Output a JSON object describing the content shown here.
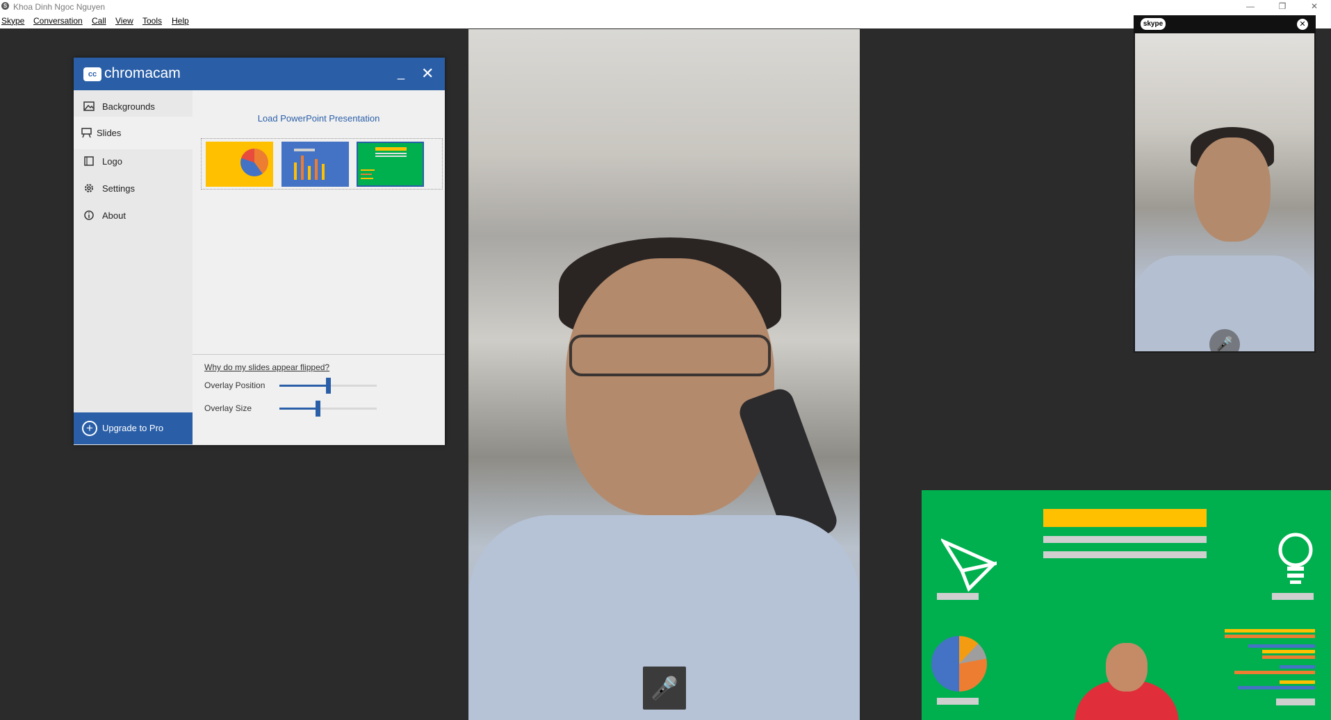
{
  "window": {
    "title": "Khoa Dinh Ngoc Nguyen",
    "app_icon": "S",
    "minimize": "—",
    "maximize": "❐",
    "close": "✕"
  },
  "menu": [
    "Skype",
    "Conversation",
    "Call",
    "View",
    "Tools",
    "Help"
  ],
  "self_view": {
    "logo": "skype",
    "close_icon": "✕",
    "mute_icon": "🎤"
  },
  "call": {
    "mute_icon": "🎤"
  },
  "chromacam": {
    "logo_icon": "cc",
    "logo_text": "chromacam",
    "minimize": "_",
    "close": "✕",
    "sidebar": [
      {
        "label": "Backgrounds",
        "icon": "image-icon"
      },
      {
        "label": "Slides",
        "icon": "easel-icon"
      },
      {
        "label": "Logo",
        "icon": "square-icon"
      },
      {
        "label": "Settings",
        "icon": "gear-icon"
      },
      {
        "label": "About",
        "icon": "info-icon"
      }
    ],
    "upgrade_label": "Upgrade to Pro",
    "load_ppt": "Load PowerPoint Presentation",
    "help_link": "Why do my slides appear flipped?",
    "overlay_position": {
      "label": "Overlay Position",
      "value": 0.5
    },
    "overlay_size": {
      "label": "Overlay Size",
      "value": 0.39
    }
  },
  "colors": {
    "brand_blue": "#2a5fa8",
    "slide_green": "#00b04f",
    "slide_yellow": "#ffc000",
    "slide_blue": "#4472c4"
  }
}
